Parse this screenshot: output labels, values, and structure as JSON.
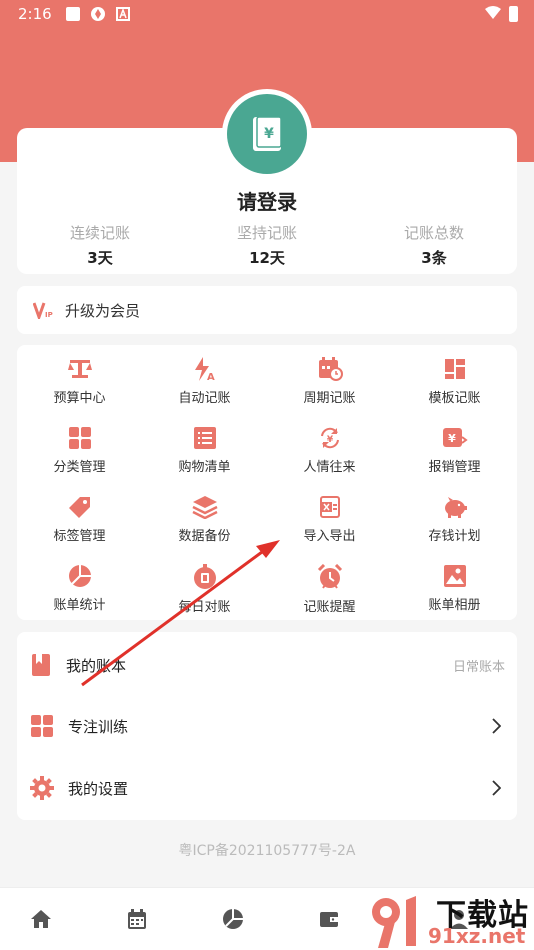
{
  "status_bar": {
    "time": "2:16"
  },
  "profile": {
    "login_text": "请登录",
    "stats": [
      {
        "label": "连续记账",
        "value": "3天"
      },
      {
        "label": "坚持记账",
        "value": "12天"
      },
      {
        "label": "记账总数",
        "value": "3条"
      }
    ]
  },
  "vip": {
    "label": "升级为会员",
    "badge": "V"
  },
  "features": [
    {
      "label": "预算中心",
      "icon": "scale-icon"
    },
    {
      "label": "自动记账",
      "icon": "auto-bolt-icon"
    },
    {
      "label": "周期记账",
      "icon": "calendar-cycle-icon"
    },
    {
      "label": "模板记账",
      "icon": "template-grid-icon"
    },
    {
      "label": "分类管理",
      "icon": "category-grid-icon"
    },
    {
      "label": "购物清单",
      "icon": "list-icon"
    },
    {
      "label": "人情往来",
      "icon": "exchange-icon"
    },
    {
      "label": "报销管理",
      "icon": "reimburse-icon"
    },
    {
      "label": "标签管理",
      "icon": "tag-icon"
    },
    {
      "label": "数据备份",
      "icon": "layers-icon"
    },
    {
      "label": "导入导出",
      "icon": "excel-icon"
    },
    {
      "label": "存钱计划",
      "icon": "piggy-bank-icon"
    },
    {
      "label": "账单统计",
      "icon": "pie-chart-icon"
    },
    {
      "label": "每日对账",
      "icon": "daily-check-icon"
    },
    {
      "label": "记账提醒",
      "icon": "alarm-clock-icon"
    },
    {
      "label": "账单相册",
      "icon": "photo-icon"
    }
  ],
  "menu": {
    "my_books": {
      "label": "我的账本",
      "value": "日常账本"
    },
    "focus_training": {
      "label": "专注训练"
    },
    "settings": {
      "label": "我的设置"
    }
  },
  "icp": "粤ICP备2021105777号-2A",
  "watermark": {
    "top": "下载站",
    "bottom": "91xz.net"
  },
  "colors": {
    "accent": "#e9756a",
    "avatar": "#4aa792"
  }
}
